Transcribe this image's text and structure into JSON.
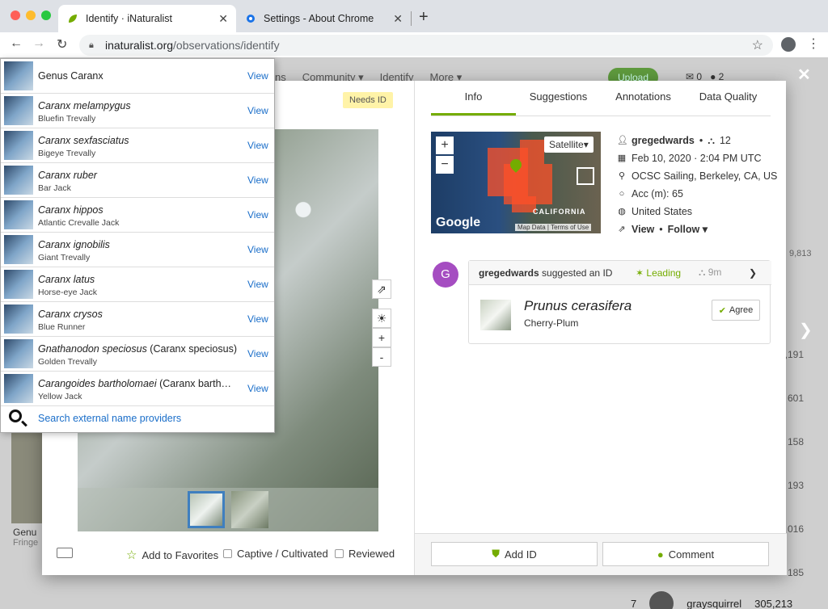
{
  "browser": {
    "tabs": [
      {
        "title": "Identify · iNaturalist",
        "active": true
      },
      {
        "title": "Settings - About Chrome",
        "active": false
      }
    ],
    "url_host": "inaturalist.org",
    "url_path": "/observations/identify"
  },
  "background": {
    "nav": [
      "ns",
      "Community ▾",
      "Identify",
      "More ▾"
    ],
    "upload_label": "Upload",
    "badge_msgs": "0",
    "badge_notes": "2",
    "right_numbers": [
      ",191",
      "601",
      "158",
      "193",
      "016",
      "185"
    ],
    "bottom_user_rank": "7",
    "bottom_user_name": "graysquirrel",
    "bottom_user_count": "305,213",
    "left_tile_text": "Genu",
    "left_tile_sub": "Fringe",
    "numbers_top": "9,813"
  },
  "modal": {
    "needs_id": "Needs ID",
    "bottom": {
      "favorites": "Add to Favorites",
      "captive": "Captive / Cultivated",
      "reviewed": "Reviewed"
    },
    "tabs": [
      "Info",
      "Suggestions",
      "Annotations",
      "Data Quality"
    ],
    "map": {
      "satellite": "Satellite",
      "region": "CALIFORNIA",
      "map_data": "Map Data",
      "terms": "Terms of Use",
      "brand": "Google"
    },
    "info": {
      "user": "gregedwards",
      "obs_count": "12",
      "date": "Feb 10, 2020 · 2:04 PM UTC",
      "place": "OCSC Sailing, Berkeley, CA, US",
      "accuracy": "Acc (m): 65",
      "country": "United States",
      "view": "View",
      "follow": "Follow ▾"
    },
    "identification": {
      "avatar_letter": "G",
      "user": "gregedwards",
      "action": "suggested an ID",
      "leading": "Leading",
      "time": "9m",
      "scientific": "Prunus cerasifera",
      "common": "Cherry-Plum",
      "agree": "Agree"
    },
    "actions": {
      "add_id": "Add ID",
      "comment": "Comment"
    }
  },
  "dropdown": {
    "items": [
      {
        "scientific": "Genus Caranx",
        "common": "",
        "view": "View",
        "single": true
      },
      {
        "scientific": "Caranx melampygus",
        "common": "Bluefin Trevally",
        "view": "View"
      },
      {
        "scientific": "Caranx sexfasciatus",
        "common": "Bigeye Trevally",
        "view": "View"
      },
      {
        "scientific": "Caranx ruber",
        "common": "Bar Jack",
        "view": "View"
      },
      {
        "scientific": "Caranx hippos",
        "common": "Atlantic Crevalle Jack",
        "view": "View"
      },
      {
        "scientific": "Caranx ignobilis",
        "common": "Giant Trevally",
        "view": "View"
      },
      {
        "scientific": "Caranx latus",
        "common": "Horse-eye Jack",
        "view": "View"
      },
      {
        "scientific": "Caranx crysos",
        "common": "Blue Runner",
        "view": "View"
      },
      {
        "scientific": "Gnathanodon speciosus",
        "extra": " (Caranx speciosus)",
        "common": "Golden Trevally",
        "view": "View"
      },
      {
        "scientific": "Carangoides bartholomaei",
        "extra": " (Caranx barth…",
        "common": "Yellow Jack",
        "view": "View"
      }
    ],
    "search_label": "Search external name providers"
  },
  "colors": {
    "accent": "#74ac00",
    "link": "#1a6ec9",
    "avatar": "#a54dc1",
    "needs_id_bg": "#fff3a8"
  }
}
